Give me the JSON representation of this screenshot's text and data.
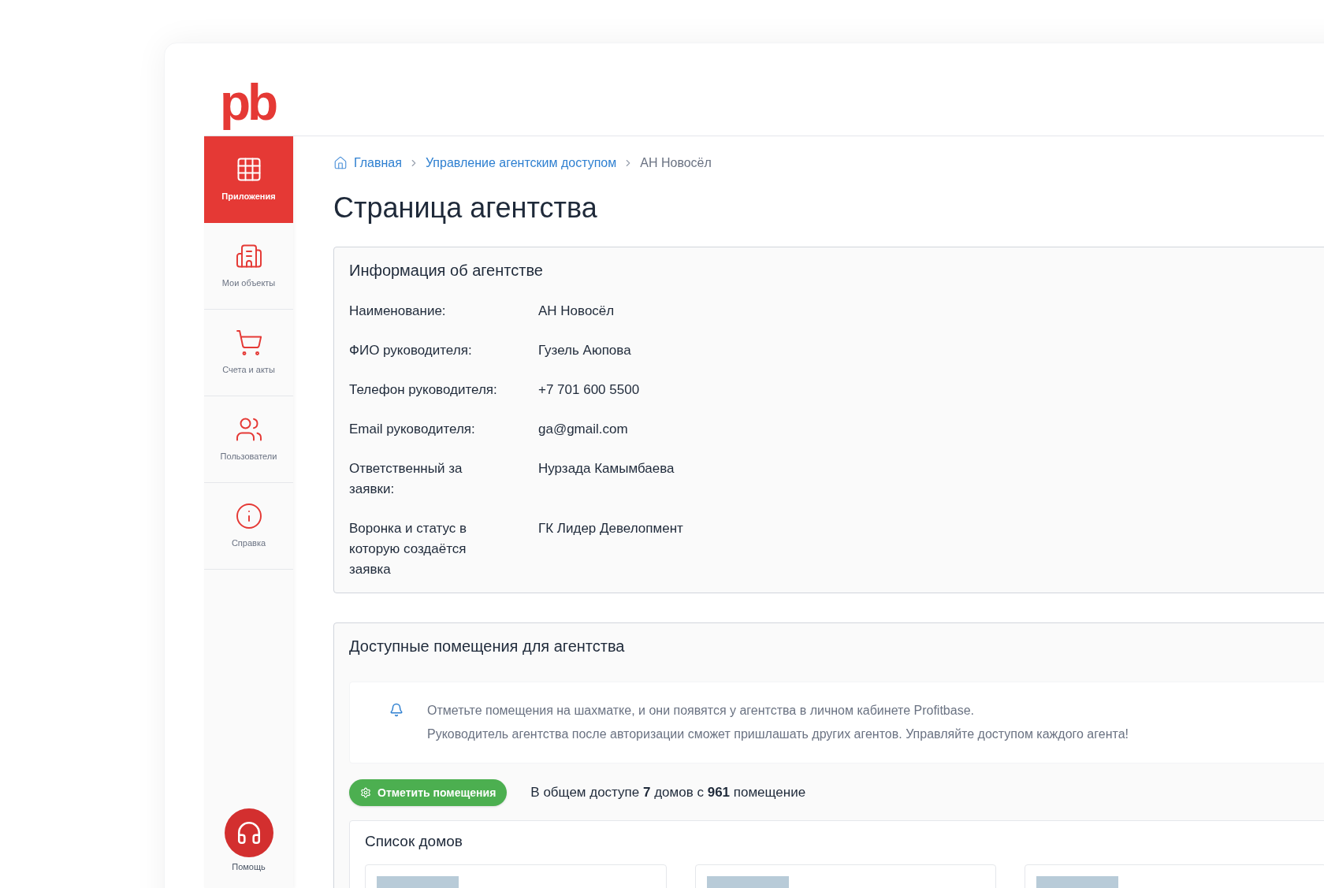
{
  "logo": {
    "text": "pb"
  },
  "sidebar": {
    "items": [
      {
        "label": "Приложения",
        "selected": true
      },
      {
        "label": "Мои объекты",
        "selected": false
      },
      {
        "label": "Счета и акты",
        "selected": false
      },
      {
        "label": "Пользователи",
        "selected": false
      },
      {
        "label": "Справка",
        "selected": false
      }
    ],
    "help": {
      "label": "Помощь"
    }
  },
  "breadcrumbs": [
    {
      "label": "Главная",
      "link": true
    },
    {
      "label": "Управление агентским доступом",
      "link": true
    },
    {
      "label": "АН Новосёл",
      "link": false
    }
  ],
  "page_title": "Страница агентства",
  "info_card": {
    "title": "Информация об агентстве",
    "rows": [
      {
        "label": "Наименование:",
        "value": "АН Новосёл"
      },
      {
        "label": "ФИО руководителя:",
        "value": "Гузель Аюпова"
      },
      {
        "label": "Телефон руководителя:",
        "value": "+7 701 600 5500"
      },
      {
        "label": "Email руководителя:",
        "value": "ga@gmail.com"
      },
      {
        "label": "Ответственный за заявки:",
        "value": "Нурзада Камымбаева"
      },
      {
        "label": "Воронка и статус в которую создаётся заявка",
        "value": "ГК Лидер Девелопмент"
      }
    ]
  },
  "rooms_card": {
    "title": "Доступные помещения для агентства",
    "notice": [
      "Отметьте помещения на шахматке, и они появятся у агентства в личном кабинете Profitbase.",
      "Руководитель агентства после авторизации сможет пришлашать других агентов. Управляйте доступом каждого агента!"
    ],
    "button": "Отметить помещения",
    "summary": "В общем доступе **7** домов с **961** помещение",
    "houses": {
      "title": "Список домов"
    }
  }
}
